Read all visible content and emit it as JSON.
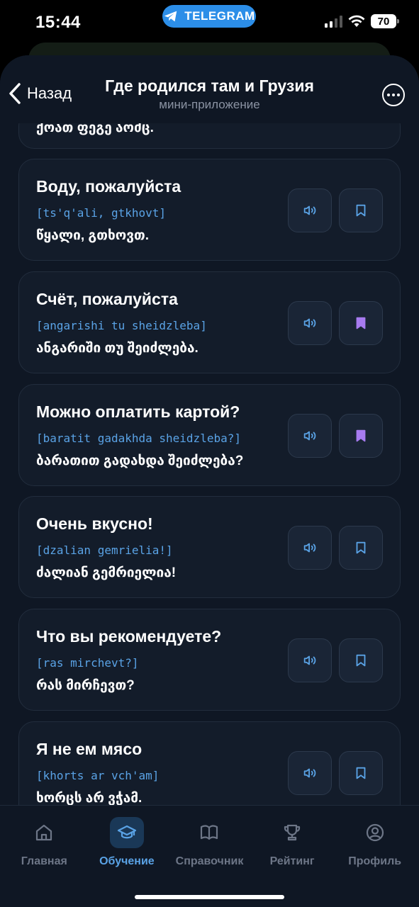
{
  "status_bar": {
    "time": "15:44",
    "telegram_label": "TELEGRAM",
    "battery": "70"
  },
  "ghost": {
    "text": ""
  },
  "nav": {
    "back_label": "Назад",
    "title": "Где родился там и Грузия",
    "subtitle": "мини-приложение"
  },
  "partial_card": {
    "georgian": "ქოათ ფეგე აოძც."
  },
  "cards": [
    {
      "phrase": "Воду, пожалуйста",
      "translit": "[ts'q'ali, gtkhovt]",
      "georgian": "წყალი, გთხოვთ.",
      "bookmarked": false
    },
    {
      "phrase": "Счёт, пожалуйста",
      "translit": "[angarishi tu sheidzleba]",
      "georgian": "ანგარიში თუ შეიძლება.",
      "bookmarked": true
    },
    {
      "phrase": "Можно оплатить картой?",
      "translit": "[baratit gadakhda sheidzleba?]",
      "georgian": "ბარათით გადახდა შეიძლება?",
      "bookmarked": true
    },
    {
      "phrase": "Очень вкусно!",
      "translit": "[dzalian gemrielia!]",
      "georgian": "ძალიან გემრიელია!",
      "bookmarked": false
    },
    {
      "phrase": "Что вы рекомендуете?",
      "translit": "[ras mirchevt?]",
      "georgian": "რას მირჩევთ?",
      "bookmarked": false
    },
    {
      "phrase": "Я не ем мясо",
      "translit": "[khorts ar vch'am]",
      "georgian": "ხორცს არ ვჭამ.",
      "bookmarked": false
    }
  ],
  "tabs": [
    {
      "label": "Главная",
      "icon": "home-icon",
      "active": false
    },
    {
      "label": "Обучение",
      "icon": "graduation-cap-icon",
      "active": true
    },
    {
      "label": "Справочник",
      "icon": "book-icon",
      "active": false
    },
    {
      "label": "Рейтинг",
      "icon": "trophy-icon",
      "active": false
    },
    {
      "label": "Профиль",
      "icon": "profile-icon",
      "active": false
    }
  ],
  "colors": {
    "accent": "#5aa3e6",
    "bookmark_active": "#a77bf0",
    "background": "#0f1724",
    "card": "#131c2a"
  }
}
